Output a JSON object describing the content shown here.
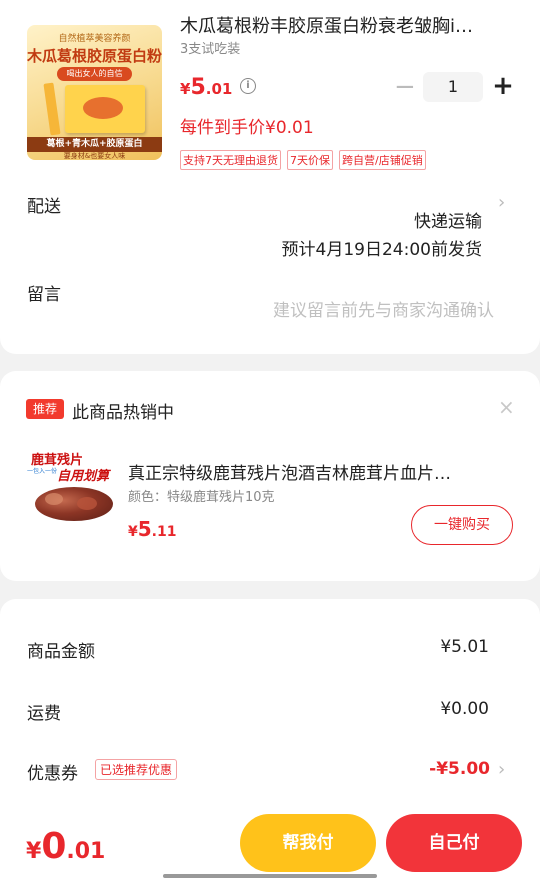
{
  "product": {
    "image": {
      "line1": "自然植萃美容养颜",
      "line2": "木瓜葛根胶原蛋白粉",
      "line3": "喝出女人的自信",
      "line4": "葛根+青木瓜+胶原蛋白",
      "line5": "要身材&也要女人味"
    },
    "title": "木瓜葛根粉丰胶原蛋白粉衰老皱胸i…",
    "spec": "3支试吃装",
    "price": {
      "currency": "¥",
      "int": "5",
      "dec": ".01"
    },
    "quantity": "1",
    "final_price": "每件到手价¥0.01",
    "tags": [
      "支持7天无理由退货",
      "7天价保",
      "跨自营/店铺促销"
    ]
  },
  "delivery": {
    "label": "配送",
    "method": "快递运输",
    "eta": "预计4月19日24:00前发货"
  },
  "note": {
    "label": "留言",
    "placeholder": "建议留言前先与商家沟通确认"
  },
  "recommend": {
    "badge": "推荐",
    "title": "此商品热销中",
    "image": {
      "line1": "鹿茸残片",
      "line2": "一包入一份",
      "line3": "自用划算"
    },
    "product_name": "真正宗特级鹿茸残片泡酒吉林鹿茸片血片…",
    "spec": "颜色：特级鹿茸残片10克",
    "price": {
      "currency": "¥",
      "int": "5",
      "dec": ".11"
    },
    "buy_label": "一键购买"
  },
  "summary": {
    "goods_label": "商品金额",
    "goods_value": "¥5.01",
    "shipping_label": "运费",
    "shipping_value": "¥0.00",
    "coupon_label": "优惠券",
    "coupon_tag": "已选推荐优惠",
    "coupon_value": "-¥5.00"
  },
  "bottom": {
    "total": {
      "currency": "¥",
      "int": "0",
      "dec": ".01"
    },
    "friend_pay": "帮我付",
    "self_pay": "自己付"
  },
  "colors": {
    "accent": "#e8272c",
    "friend_btn": "#ffc21a",
    "self_btn": "#f2343a"
  }
}
